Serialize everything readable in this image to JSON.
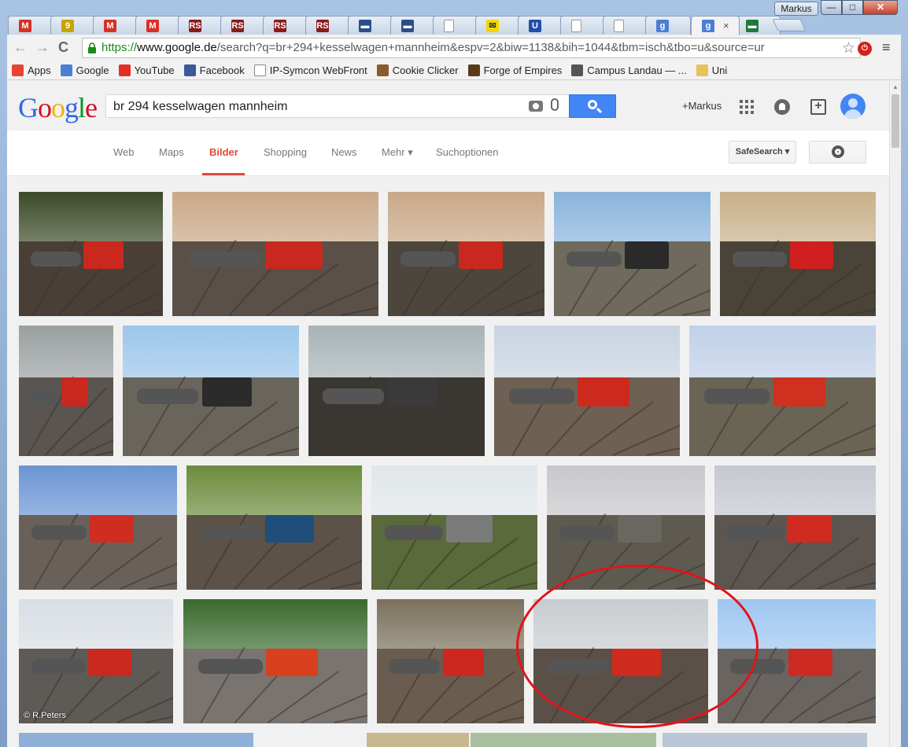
{
  "window": {
    "profile_name": "Markus",
    "controls": [
      "—",
      "□",
      "✕"
    ]
  },
  "tabs": [
    {
      "favicon": "gmail-icon",
      "color": "#d93025",
      "glyph": "M"
    },
    {
      "favicon": "site-icon",
      "color": "#c8a400",
      "glyph": "9"
    },
    {
      "favicon": "gmail-icon",
      "color": "#d93025",
      "glyph": "M"
    },
    {
      "favicon": "gmail-icon",
      "color": "#d93025",
      "glyph": "M"
    },
    {
      "favicon": "rs-icon",
      "color": "#8a1c1c",
      "glyph": "RS"
    },
    {
      "favicon": "rs-icon",
      "color": "#8a1c1c",
      "glyph": "RS"
    },
    {
      "favicon": "rs-icon",
      "color": "#8a1c1c",
      "glyph": "RS"
    },
    {
      "favicon": "rs-icon",
      "color": "#8a1c1c",
      "glyph": "RS"
    },
    {
      "favicon": "train-icon",
      "color": "#2b4e8a",
      "glyph": "▬"
    },
    {
      "favicon": "train-icon",
      "color": "#2b4e8a",
      "glyph": "▬"
    },
    {
      "favicon": "page-icon",
      "color": "#ffffff",
      "glyph": ""
    },
    {
      "favicon": "yellow-icon",
      "color": "#f2d600",
      "glyph": "✉"
    },
    {
      "favicon": "u-icon",
      "color": "#1f4fa8",
      "glyph": "U"
    },
    {
      "favicon": "page-icon",
      "color": "#ffffff",
      "glyph": ""
    },
    {
      "favicon": "page-icon",
      "color": "#ffffff",
      "glyph": ""
    },
    {
      "favicon": "google-icon",
      "color": "#4a7fd4",
      "glyph": "g"
    },
    {
      "favicon": "google-icon",
      "color": "#4a7fd4",
      "glyph": "g",
      "active": true,
      "close": "×"
    },
    {
      "favicon": "flag-icon",
      "color": "#1e7a3a",
      "glyph": "▬"
    }
  ],
  "toolbar": {
    "url_scheme": "https://",
    "url_host": "www.google.de",
    "url_rest": "/search?q=br+294+kesselwagen+mannheim&espv=2&biw=1138&bih=1044&tbm=isch&tbo=u&source=ur",
    "star": "☆",
    "menu": "≡",
    "back": "←",
    "forward": "→",
    "reload": "C"
  },
  "bookmarks": [
    {
      "label": "Apps",
      "icon": "apps-icon",
      "color": "#e94235"
    },
    {
      "label": "Google",
      "icon": "google-icon",
      "color": "#4a7fd4"
    },
    {
      "label": "YouTube",
      "icon": "youtube-icon",
      "color": "#e52d27"
    },
    {
      "label": "Facebook",
      "icon": "facebook-icon",
      "color": "#3b5998"
    },
    {
      "label": "IP-Symcon WebFront",
      "icon": "page-icon",
      "color": "#ffffff"
    },
    {
      "label": "Cookie Clicker",
      "icon": "cookie-icon",
      "color": "#8b5a2b"
    },
    {
      "label": "Forge of Empires",
      "icon": "forge-icon",
      "color": "#5a3a1a"
    },
    {
      "label": "Campus Landau — ...",
      "icon": "campus-icon",
      "color": "#555555"
    },
    {
      "label": "Uni",
      "icon": "folder-icon",
      "color": "#e8c35a"
    }
  ],
  "search": {
    "logo": "Google",
    "query": "br 294 kesselwagen mannheim",
    "plus_user": "+Markus"
  },
  "nav": {
    "tabs": [
      {
        "label": "Web",
        "active": false
      },
      {
        "label": "Maps",
        "active": false
      },
      {
        "label": "Bilder",
        "active": true
      },
      {
        "label": "Shopping",
        "active": false
      },
      {
        "label": "News",
        "active": false
      },
      {
        "label": "Mehr ▾",
        "active": false
      },
      {
        "label": "Suchoptionen",
        "active": false
      }
    ],
    "safesearch": "SafeSearch ▾"
  },
  "images": {
    "credit_text": "© R.Peters",
    "rows": [
      [
        {
          "name": "image-result-1",
          "sky": "#3c4a28",
          "ground": "#4a3f36",
          "loco": "#c8281e"
        },
        {
          "name": "image-result-2",
          "sky": "#c8a888",
          "ground": "#5a5048",
          "loco": "#c8281e"
        },
        {
          "name": "image-result-3",
          "sky": "#c8a888",
          "ground": "#4d463d",
          "loco": "#c8281e"
        },
        {
          "name": "image-result-4",
          "sky": "#8ab4dc",
          "ground": "#6f6a5c",
          "loco": "#2a2a2a"
        },
        {
          "name": "image-result-5",
          "sky": "#c8b08a",
          "ground": "#4a4438",
          "loco": "#cf1f1f"
        }
      ],
      [
        {
          "name": "image-result-6",
          "sky": "#9aa0a0",
          "ground": "#5a5550",
          "loco": "#c8281e"
        },
        {
          "name": "image-result-7",
          "sky": "#9cc6ea",
          "ground": "#6a655a",
          "loco": "#2b2b2b"
        },
        {
          "name": "image-result-8",
          "sky": "#a8b3b7",
          "ground": "#3a3632",
          "loco": "#3a3a3a"
        },
        {
          "name": "image-result-9",
          "sky": "#c8d4e0",
          "ground": "#6e6052",
          "loco": "#cc2a1e"
        },
        {
          "name": "image-result-10",
          "sky": "#c0d0e8",
          "ground": "#6a6454",
          "loco": "#cf3020"
        }
      ],
      [
        {
          "name": "image-result-11",
          "sky": "#6b95d4",
          "ground": "#6a605a",
          "loco": "#cf2d22"
        },
        {
          "name": "image-result-12",
          "sky": "#6c8c3c",
          "ground": "#5c5248",
          "loco": "#1f4e7a"
        },
        {
          "name": "image-result-13",
          "sky": "#e0e6ea",
          "ground": "#5a6a3a",
          "loco": "#7a7a7a"
        },
        {
          "name": "image-result-14",
          "sky": "#c8c8cc",
          "ground": "#5e5a50",
          "loco": "#6a6660"
        },
        {
          "name": "image-result-15",
          "sky": "#c4c8d0",
          "ground": "#5c5550",
          "loco": "#cf2b20"
        }
      ],
      [
        {
          "name": "image-result-16",
          "sky": "#d8dee4",
          "ground": "#5e5a56",
          "loco": "#c8281e",
          "credit": true
        },
        {
          "name": "image-result-17",
          "sky": "#3a6a2e",
          "ground": "#7a7470",
          "loco": "#d8401e"
        },
        {
          "name": "image-result-18",
          "sky": "#7a705c",
          "ground": "#6a5c4e",
          "loco": "#cc2820"
        },
        {
          "name": "image-result-19",
          "sky": "#c8ccd0",
          "ground": "#5a5048",
          "loco": "#cf2a1e"
        },
        {
          "name": "image-result-20",
          "sky": "#9ec6f0",
          "ground": "#6a6460",
          "loco": "#cc2a22"
        }
      ]
    ]
  }
}
